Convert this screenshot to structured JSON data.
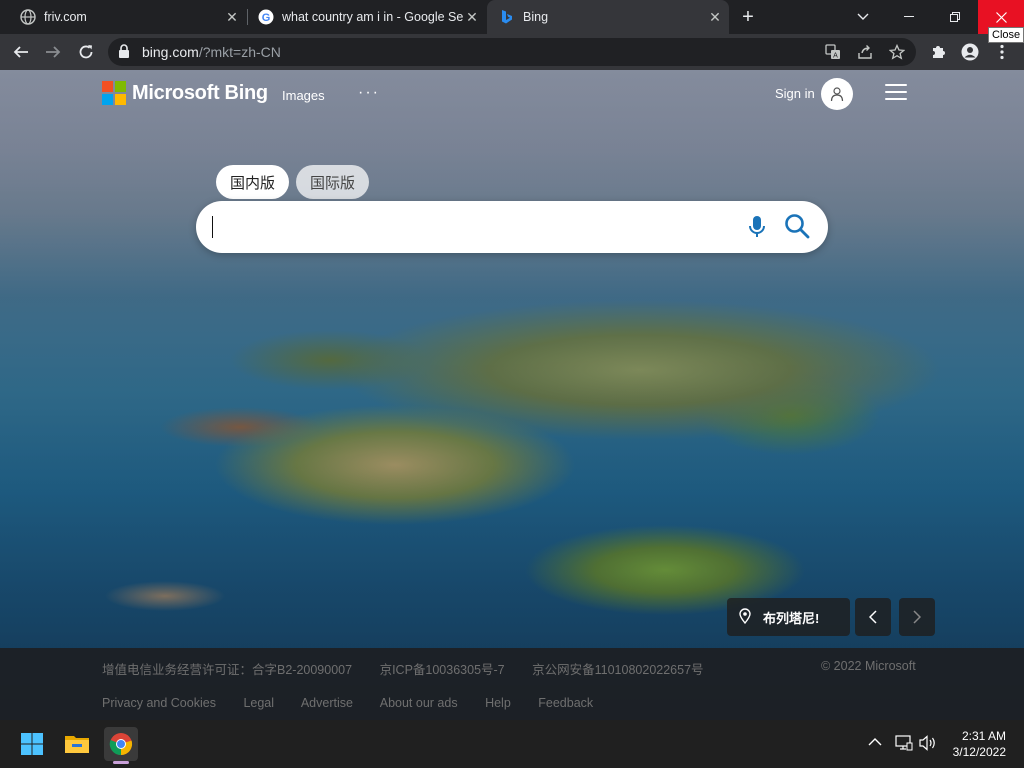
{
  "browser": {
    "tabs": [
      {
        "title": "friv.com",
        "favicon": "globe-icon"
      },
      {
        "title": "what country am i in - Google Se",
        "favicon": "google-icon"
      },
      {
        "title": "Bing",
        "favicon": "bing-icon",
        "active": true
      }
    ],
    "tooltip": "Close",
    "url_host": "bing.com",
    "url_rest": "/?mkt=zh-CN"
  },
  "bing": {
    "logo_text": "Microsoft Bing",
    "nav_images": "Images",
    "nav_more": "···",
    "sign_in": "Sign in",
    "scope_domestic": "国内版",
    "scope_international": "国际版",
    "search_value": "",
    "location_label": "布列塔尼!",
    "footer": {
      "row1": [
        "增值电信业务经营许可证：合字B2-20090007",
        "京ICP备10036305号-7",
        "京公网安备11010802022657号"
      ],
      "copyright": "© 2022 Microsoft",
      "row2": [
        "Privacy and Cookies",
        "Legal",
        "Advertise",
        "About our ads",
        "Help",
        "Feedback"
      ]
    },
    "colors": {
      "ms_red": "#f25022",
      "ms_green": "#7fba00",
      "ms_blue": "#00a4ef",
      "ms_yellow": "#ffb900",
      "search_icon": "#1a73b8"
    }
  },
  "taskbar": {
    "time": "2:31 AM",
    "date": "3/12/2022"
  }
}
